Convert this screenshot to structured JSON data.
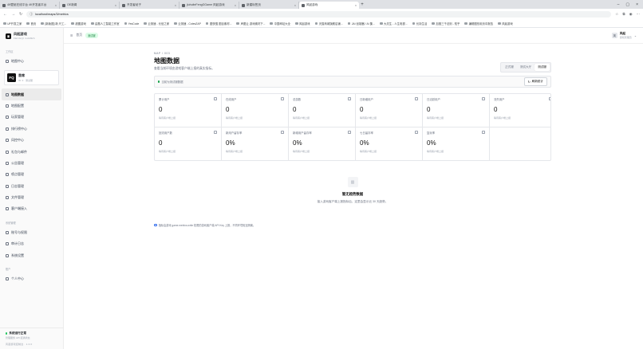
{
  "browser": {
    "tabs": [
      {
        "label": "4K壁纸在线平台 4K开发者平台",
        "active": false
      },
      {
        "label": "OE新闻",
        "active": false
      },
      {
        "label": "开发者帖子",
        "active": false
      },
      {
        "label": "jiuhuiteFengGGame 风起游戏",
        "active": false
      },
      {
        "label": "新建标签页",
        "active": false
      },
      {
        "label": "风起游戏",
        "active": true
      }
    ],
    "url": "localhost/maps/3/metrics",
    "bookmarks": [
      "UP开发之家",
      "首页",
      "[新版图] 新 尺工...",
      "超图游戏",
      "由题人工智能工作室",
      "YesCode",
      "云测速 - 长信之家",
      "云测速 - CotesZAP",
      "图快搜 图目素材...",
      "声图让 游戏素材下...",
      "中国坤站大全",
      "风起游戏",
      "天猫商城旗舰店铺...",
      "JAI 创制器 / AI 集...",
      "大灵生 - 人生电视...",
      "长持生活",
      "加推三千法则 - 知乎",
      "编辑图形用页中报告",
      "风起游戏"
    ]
  },
  "sidebar": {
    "brand_name": "风起游戏",
    "brand_sub": "FENGQI GAMES",
    "section_workspace": "工作区",
    "item_overview": "地图中心",
    "game_card": {
      "logo": "FQ",
      "name": "首席",
      "meta": "ID: 3 · 测试服"
    },
    "items": [
      "地图数据",
      "地图配置",
      "玩家管理",
      "排行榜中心",
      "风控中心",
      "礼包与邮件",
      "公告管理",
      "喷点管理",
      "日志管理",
      "文件管理",
      "客户端接入"
    ],
    "section_system": "系统管理",
    "system_items": [
      "账号与权限",
      "审计日志",
      "系统设置"
    ],
    "section_account": "账户",
    "account_items": [
      "个人中心"
    ],
    "footer_status": "系统运行正常",
    "footer_sub": "管理服务 API 接通状态",
    "footer_copy": "风起游戏控制台 · 1.0.0"
  },
  "topbar": {
    "home": "首页",
    "sep": "/",
    "env": "测试服",
    "avatar": "风",
    "user_name": "风起",
    "user_role": "游戏管理员"
  },
  "page": {
    "eyebrow": "MAP / 003",
    "title": "地图数据",
    "desc": "查看当前环境由游戏客户端上报的真实指标。",
    "segments": [
      "正式服",
      "测试大厅",
      "测试服"
    ],
    "active_segment": 2,
    "notice": "当前为测试服数据",
    "refresh": "刷新统计",
    "metrics": [
      {
        "label": "累计用户",
        "value": "0",
        "sub": "等待客户端上报"
      },
      {
        "label": "在线用户",
        "value": "0",
        "sub": "等待客户端上报"
      },
      {
        "label": "总游数",
        "value": "0",
        "sub": "等待客户端上报"
      },
      {
        "label": "日新增用户",
        "value": "0",
        "sub": "等待客户端上报"
      },
      {
        "label": "日活跃用户",
        "value": "0",
        "sub": "等待客户端上报"
      },
      {
        "label": "流失用户",
        "value": "0",
        "sub": "等待客户端上报"
      },
      {
        "label": "回流用户数",
        "value": "0",
        "sub": "等待客户端上报"
      },
      {
        "label": "新用户留存率",
        "value": "0%",
        "sub": "等待客户端上报"
      },
      {
        "label": "新增用户留存率",
        "value": "0%",
        "sub": "等待客户端上报"
      },
      {
        "label": "七日留存率",
        "value": "0%",
        "sub": "等待客户端上报"
      },
      {
        "label": "复玩率",
        "value": "0%",
        "sub": "等待客户端上报"
      }
    ],
    "empty_icon": "▥",
    "empty_title": "暂无趋势数据",
    "empty_desc": "接入游戏客户端上报指标后，这里会显示近 30 天趋势。",
    "footnote": "指标由游戏 game.metrics.write 权限的游戏客户端 API Key 上报，不同环境相互隔离。"
  }
}
